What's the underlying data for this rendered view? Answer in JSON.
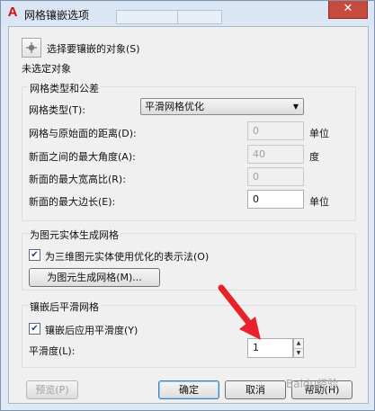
{
  "window": {
    "title": "网格镶嵌选项",
    "close_glyph": "✕",
    "app_icon_glyph": "A"
  },
  "object_select": {
    "button_label": "选择要镶嵌的对象(S)",
    "status": "未选定对象"
  },
  "mesh_type_group": {
    "title": "网格类型和公差",
    "mesh_type_label": "网格类型(T):",
    "mesh_type_value": "平滑网格优化",
    "distance_label": "网格与原始面的距离(D):",
    "distance_value": "0",
    "distance_unit": "单位",
    "angle_label": "新面之间的最大角度(A):",
    "angle_value": "40",
    "angle_unit": "度",
    "aspect_label": "新面的最大宽高比(R):",
    "aspect_value": "0",
    "edge_label": "新面的最大边长(E):",
    "edge_value": "0",
    "edge_unit": "单位"
  },
  "primitive_group": {
    "title": "为图元实体生成网格",
    "optimized_checkbox_label": "为三维图元实体使用优化的表示法(O)",
    "optimized_checked": true,
    "generate_button_label": "为图元生成网格(M)..."
  },
  "smooth_group": {
    "title": "镶嵌后平滑网格",
    "apply_checkbox_label": "镶嵌后应用平滑度(Y)",
    "apply_checked": true,
    "level_label": "平滑度(L):",
    "level_value": "1"
  },
  "footer": {
    "preview_label": "预览(P)",
    "ok_label": "确定",
    "cancel_label": "取消",
    "help_label": "帮助(H)"
  },
  "watermark_text": "Baidu经验",
  "colors": {
    "annotation_arrow": "#e8212b",
    "close_button": "#c74b3d",
    "title_bar": "#dbe6f4"
  },
  "icons": {
    "app": "autocad-logo-icon",
    "pick": "crosshair-pick-icon",
    "dropdown": "chevron-down-icon",
    "check": "checkmark-icon",
    "spin_up": "spin-up-icon",
    "spin_down": "spin-down-icon",
    "close": "close-icon"
  }
}
